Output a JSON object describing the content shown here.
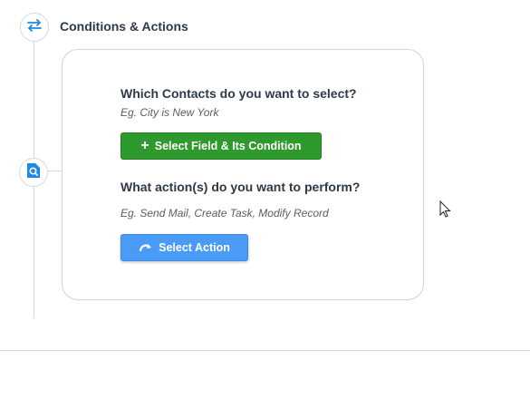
{
  "section": {
    "title": "Conditions & Actions",
    "icon": "swap-arrows-icon"
  },
  "card": {
    "contacts_question": "Which Contacts do you want to select?",
    "contacts_hint": "Eg. City is New York",
    "field_button_label": "Select Field & Its Condition",
    "actions_question": "What action(s) do you want to perform?",
    "actions_hint": "Eg. Send Mail, Create Task, Modify Record",
    "action_button_label": "Select Action"
  },
  "colors": {
    "accent_blue": "#4a9bf6",
    "success_green": "#2e9a2e",
    "icon_blue": "#1e88e5"
  }
}
